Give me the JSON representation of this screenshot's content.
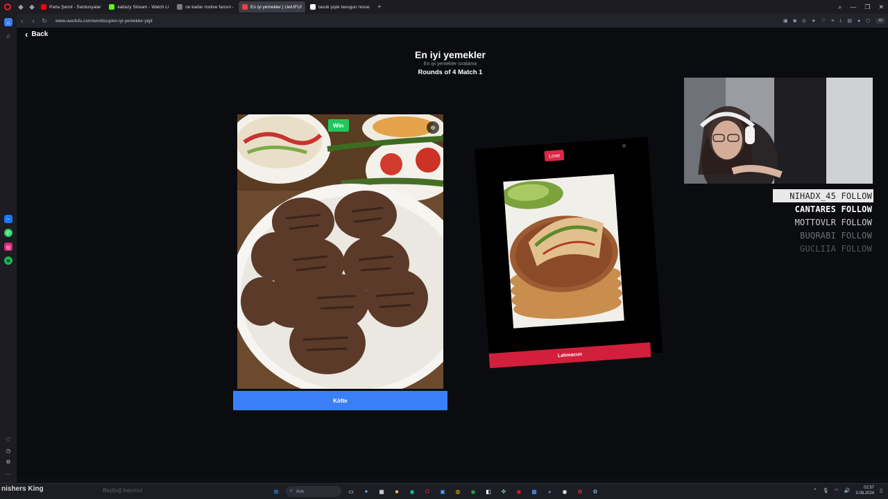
{
  "browser": {
    "tabs": [
      {
        "label": "Parla Şenol - Sardunyalar",
        "color": "#ff0000",
        "active": false
      },
      {
        "label": "katiazy Stream - Watch Li",
        "color": "#53fc18",
        "active": false
      },
      {
        "label": "ne kadar motive fansın -",
        "color": "#7d7d7d",
        "active": false
      },
      {
        "label": "En iyi yemekler | UwUFU!",
        "color": "#e2443a",
        "active": true
      },
      {
        "label": "tavuk şişte tavugun nrese",
        "color": "#ffffff",
        "active": false
      }
    ],
    "url": "www.uwufufu.com/worldcup/en-iyi-yemekler-yigit",
    "ai_badge": "AI"
  },
  "page": {
    "back_label": "Back",
    "title": "En iyi yemekler",
    "subtitle": "En iyi yemekler sıralama",
    "round_info": "Rounds of 4 Match 1"
  },
  "left_choice": {
    "badge": "Win",
    "name": "Köfte",
    "badge_color": "#22c55e",
    "button_color": "#3a7ff6"
  },
  "right_choice": {
    "badge": "Lose",
    "name": "Lahmacun",
    "badge_color": "#dc2645",
    "button_color": "#d21f3c"
  },
  "stream": {
    "followers": [
      {
        "text": "NIHADX_45 FOLLOW",
        "style": "hl"
      },
      {
        "text": "CANTARES FOLLOW",
        "style": "c1"
      },
      {
        "text": "MOTTOVLR FOLLOW",
        "style": "c2"
      },
      {
        "text": "BUQRABI FOLLOW",
        "style": "c3"
      },
      {
        "text": "GUCLIIA FOLLOW",
        "style": "c4"
      }
    ]
  },
  "taskbar": {
    "left_text": "nishers King",
    "left_faded": "Başbuğ başımız",
    "search_placeholder": "Ara",
    "time": "02:57",
    "date": "3.08.2024"
  }
}
